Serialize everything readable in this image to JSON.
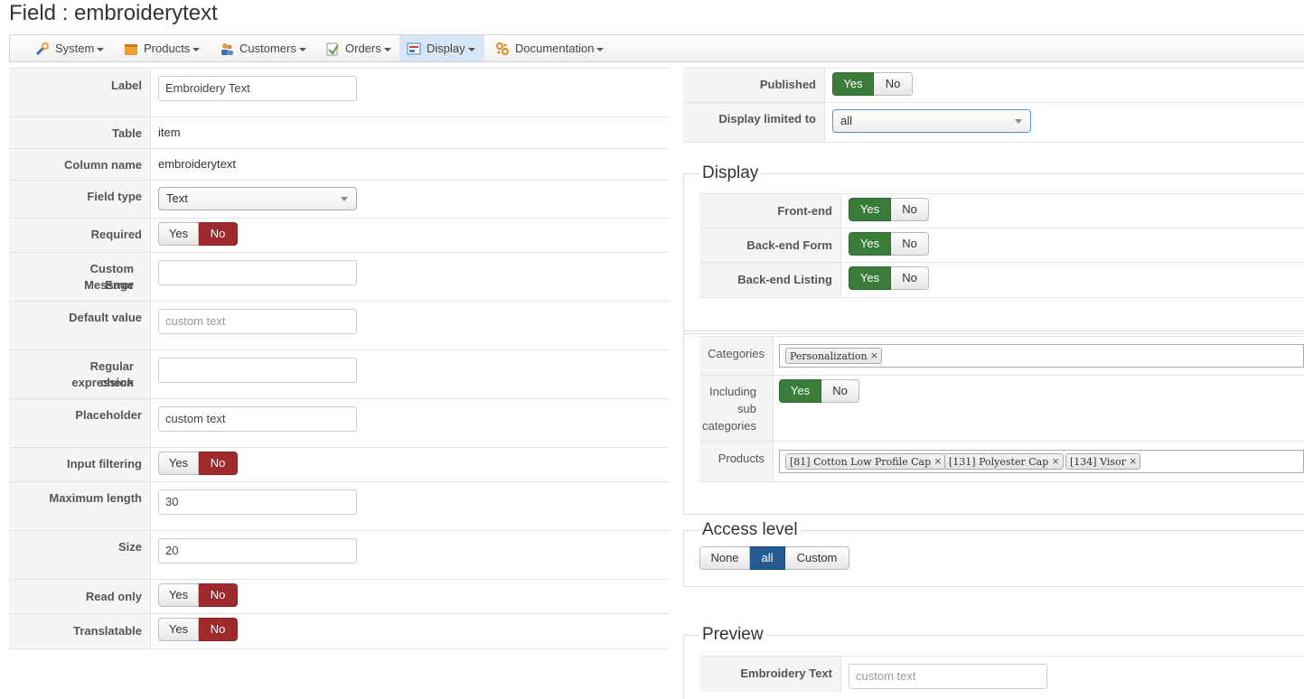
{
  "title": "Field : embroiderytext",
  "menu": [
    {
      "label": "System",
      "icon": "tools-icon",
      "color": "#3a6ea5"
    },
    {
      "label": "Products",
      "icon": "box-icon",
      "color": "#f0a030"
    },
    {
      "label": "Customers",
      "icon": "users-icon",
      "color": "#d08a2a"
    },
    {
      "label": "Orders",
      "icon": "orders-icon",
      "color": "#6a9a3a"
    },
    {
      "label": "Display",
      "icon": "display-icon",
      "color": "#4a7fb8"
    },
    {
      "label": "Documentation",
      "icon": "gears-icon",
      "color": "#e08a20"
    }
  ],
  "left": {
    "label": {
      "key": "Label",
      "value": "Embroidery Text"
    },
    "table": {
      "key": "Table",
      "value": "item"
    },
    "column": {
      "key": "Column name",
      "value": "embroiderytext"
    },
    "field_type": {
      "key": "Field type",
      "value": "Text"
    },
    "required": {
      "key": "Required",
      "yes": "Yes",
      "no": "No",
      "selected": "No"
    },
    "custom_error": {
      "key_1": "Custom Error",
      "key_2": "Message",
      "value": ""
    },
    "default_value": {
      "key": "Default value",
      "placeholder": "custom text"
    },
    "regex": {
      "key_1": "Regular expression",
      "key_2": "check",
      "value": ""
    },
    "placeholder": {
      "key": "Placeholder",
      "value": "custom text"
    },
    "input_filtering": {
      "key": "Input filtering",
      "yes": "Yes",
      "no": "No",
      "selected": "No"
    },
    "max_length": {
      "key": "Maximum length",
      "value": "30"
    },
    "size": {
      "key": "Size",
      "value": "20"
    },
    "read_only": {
      "key": "Read only",
      "yes": "Yes",
      "no": "No",
      "selected": "No"
    },
    "translatable": {
      "key": "Translatable",
      "yes": "Yes",
      "no": "No",
      "selected": "No"
    }
  },
  "right": {
    "published": {
      "key": "Published",
      "yes": "Yes",
      "no": "No",
      "selected": "Yes"
    },
    "display_limited": {
      "key": "Display limited to",
      "value": "all"
    },
    "display": {
      "legend": "Display",
      "front_end": {
        "key": "Front-end",
        "yes": "Yes",
        "no": "No",
        "selected": "Yes"
      },
      "backend_form": {
        "key": "Back-end Form",
        "yes": "Yes",
        "no": "No",
        "selected": "Yes"
      },
      "backend_listing": {
        "key": "Back-end Listing",
        "yes": "Yes",
        "no": "No",
        "selected": "Yes"
      }
    },
    "categories": {
      "key": "Categories",
      "chips": [
        "Personalization"
      ]
    },
    "sub_categories": {
      "key_1": "Including",
      "key_2": "sub",
      "key_3": "categories",
      "yes": "Yes",
      "no": "No",
      "selected": "Yes"
    },
    "products": {
      "key": "Products",
      "chips": [
        "[81] Cotton Low Profile Cap",
        "[131] Polyester Cap",
        "[134] Visor"
      ]
    },
    "access": {
      "legend": "Access level",
      "options": [
        "None",
        "all",
        "Custom"
      ],
      "selected": "all"
    },
    "preview": {
      "legend": "Preview",
      "key": "Embroidery Text",
      "placeholder": "custom text"
    }
  },
  "colors": {
    "yes_active": "#3a7d3a",
    "no_active": "#9e2a2b",
    "access_active": "#245a8f"
  }
}
